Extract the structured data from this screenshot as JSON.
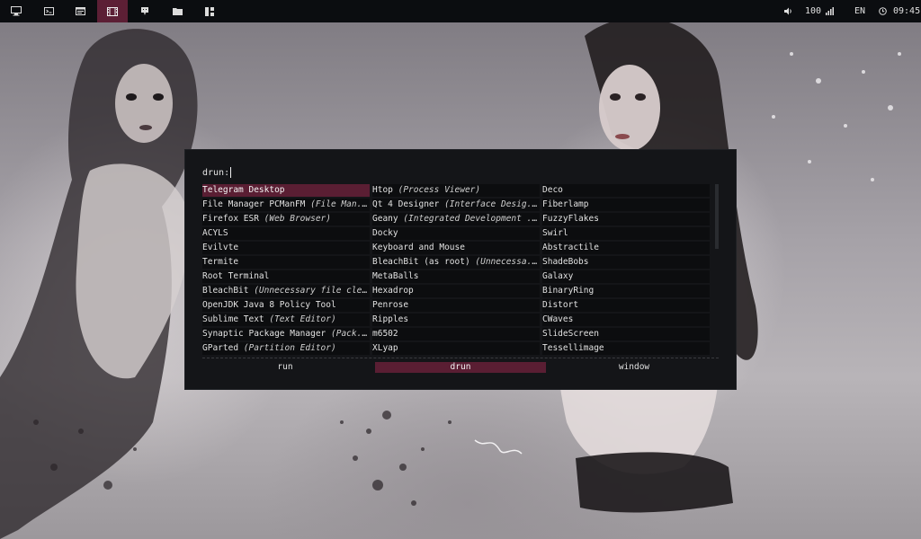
{
  "panel": {
    "workspaces": [
      {
        "icon": "monitor-icon"
      },
      {
        "icon": "terminal-icon"
      },
      {
        "icon": "browser-icon"
      },
      {
        "icon": "film-icon",
        "active": true
      },
      {
        "icon": "chat-icon"
      },
      {
        "icon": "folder-icon"
      },
      {
        "icon": "layout-icon"
      }
    ],
    "volume": "100",
    "keyboard_layout": "EN",
    "clock": "09:45"
  },
  "launcher": {
    "prompt": "drun:",
    "columns": [
      [
        {
          "name": "Telegram Desktop",
          "generic": "",
          "selected": true
        },
        {
          "name": "File Manager PCManFM ",
          "generic": "(File Man..."
        },
        {
          "name": "Firefox ESR ",
          "generic": "(Web Browser)"
        },
        {
          "name": "ACYLS",
          "generic": ""
        },
        {
          "name": "Evilvte",
          "generic": ""
        },
        {
          "name": "Termite",
          "generic": ""
        },
        {
          "name": "Root Terminal",
          "generic": ""
        },
        {
          "name": "BleachBit ",
          "generic": "(Unnecessary file cle..."
        },
        {
          "name": "OpenJDK Java 8 Policy Tool",
          "generic": ""
        },
        {
          "name": "Sublime Text ",
          "generic": "(Text Editor)"
        },
        {
          "name": "Synaptic Package Manager ",
          "generic": "(Pack..."
        },
        {
          "name": "GParted ",
          "generic": "(Partition Editor)"
        }
      ],
      [
        {
          "name": "Htop ",
          "generic": "(Process Viewer)"
        },
        {
          "name": "Qt 4 Designer ",
          "generic": "(Interface Desig..."
        },
        {
          "name": "Geany ",
          "generic": "(Integrated Development ..."
        },
        {
          "name": "Docky",
          "generic": ""
        },
        {
          "name": "Keyboard and Mouse",
          "generic": ""
        },
        {
          "name": "BleachBit (as root) ",
          "generic": "(Unnecessa..."
        },
        {
          "name": "MetaBalls",
          "generic": ""
        },
        {
          "name": "Hexadrop",
          "generic": ""
        },
        {
          "name": "Penrose",
          "generic": ""
        },
        {
          "name": "Ripples",
          "generic": ""
        },
        {
          "name": "m6502",
          "generic": ""
        },
        {
          "name": "XLyap",
          "generic": ""
        }
      ],
      [
        {
          "name": "Deco",
          "generic": ""
        },
        {
          "name": "Fiberlamp",
          "generic": ""
        },
        {
          "name": "FuzzyFlakes",
          "generic": ""
        },
        {
          "name": "Swirl",
          "generic": ""
        },
        {
          "name": "Abstractile",
          "generic": ""
        },
        {
          "name": "ShadeBobs",
          "generic": ""
        },
        {
          "name": "Galaxy",
          "generic": ""
        },
        {
          "name": "BinaryRing",
          "generic": ""
        },
        {
          "name": "Distort",
          "generic": ""
        },
        {
          "name": "CWaves",
          "generic": ""
        },
        {
          "name": "SlideScreen",
          "generic": ""
        },
        {
          "name": "Tessellimage",
          "generic": ""
        }
      ]
    ],
    "modes": [
      {
        "label": "run",
        "active": false
      },
      {
        "label": "drun",
        "active": true
      },
      {
        "label": "window",
        "active": false
      }
    ]
  },
  "colors": {
    "panel_bg": "#0b0d10",
    "accent": "#5a1e33",
    "launcher_bg": "#141518"
  }
}
